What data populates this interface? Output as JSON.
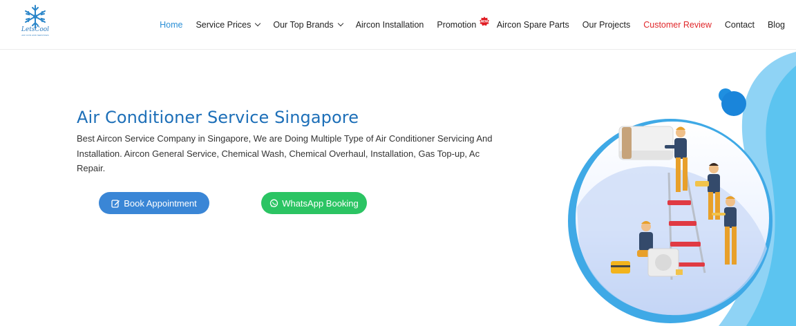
{
  "header": {
    "logo_text": "LetsCool",
    "logo_subtext": "AIR CON AND SERVICES",
    "nav": [
      {
        "label": "Home",
        "state": "active",
        "dropdown": false
      },
      {
        "label": "Service Prices",
        "state": "normal",
        "dropdown": true
      },
      {
        "label": "Our Top Brands",
        "state": "normal",
        "dropdown": true
      },
      {
        "label": "Aircon Installation",
        "state": "normal",
        "dropdown": false
      },
      {
        "label": "Promotion",
        "state": "normal",
        "dropdown": false,
        "badge": "NEW"
      },
      {
        "label": "Aircon Spare Parts",
        "state": "normal",
        "dropdown": false
      },
      {
        "label": "Our Projects",
        "state": "normal",
        "dropdown": false
      },
      {
        "label": "Customer Review",
        "state": "highlight",
        "dropdown": false
      },
      {
        "label": "Contact",
        "state": "normal",
        "dropdown": false
      },
      {
        "label": "Blog",
        "state": "normal",
        "dropdown": false
      }
    ]
  },
  "hero": {
    "title": "Air Conditioner Service Singapore",
    "description": "Best Aircon Service Company in Singapore, We are Doing Multiple Type of Air Conditioner Servicing  And Installation. Aircon General Service, Chemical Wash,  Chemical Overhaul, Installation, Gas Top-up, Ac Repair.",
    "book_button": {
      "label": "Book Appointment",
      "icon": "edit-icon"
    },
    "whatsapp_button": {
      "label": "WhatsApp Booking",
      "icon": "whatsapp-icon"
    }
  },
  "colors": {
    "brand_blue": "#1d6fb8",
    "nav_active": "#2b8fd6",
    "nav_highlight": "#e0272a",
    "book_button": "#3a86d6",
    "whatsapp_button": "#2bc463"
  }
}
